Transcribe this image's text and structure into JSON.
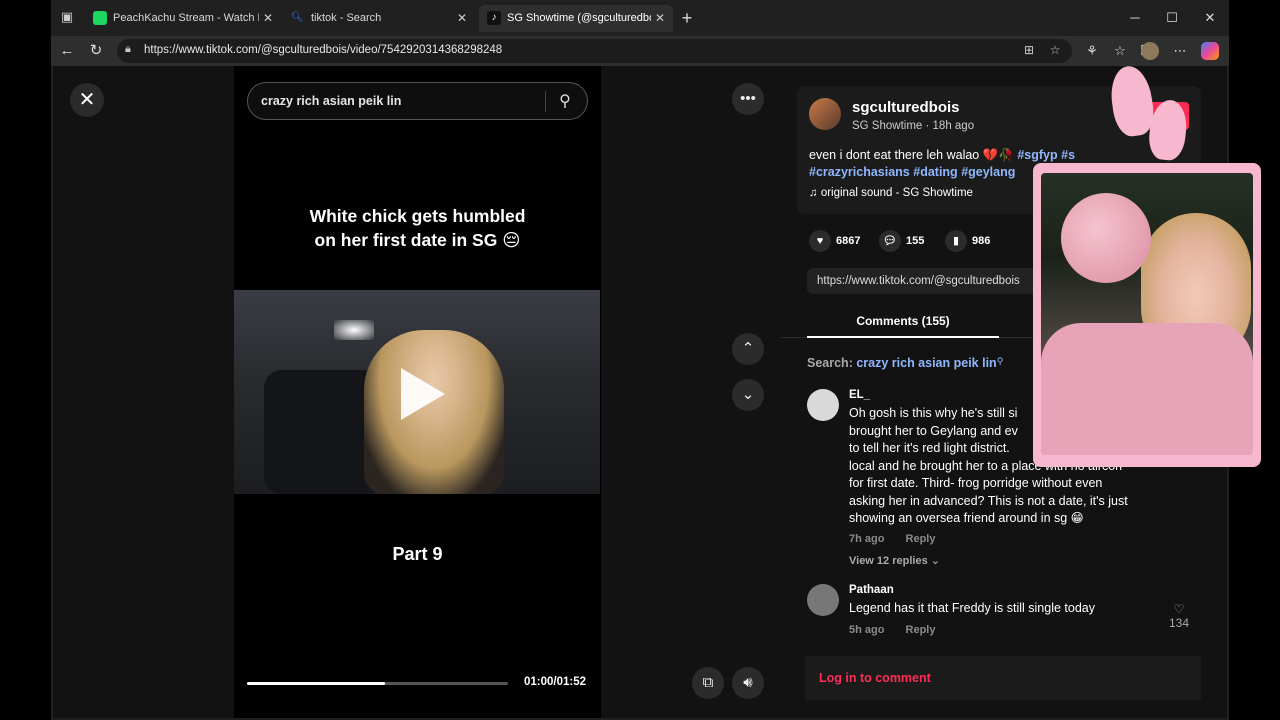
{
  "browser": {
    "tabs": [
      {
        "title": "PeachKachu Stream - Watch Live",
        "favicon_color": "#1ed760"
      },
      {
        "title": "tiktok - Search",
        "favicon_color": "#3b82f6"
      },
      {
        "title": "SG Showtime (@sgculturedbois)",
        "favicon_color": "#111111"
      }
    ],
    "url": "https://www.tiktok.com/@sgculturedbois/video/7542920314368298248"
  },
  "video": {
    "search_query": "crazy rich asian peik lin",
    "caption_line1": "White chick gets humbled",
    "caption_line2": "on her first date in SG 😔",
    "part_label": "Part 9",
    "time": "01:00/01:52",
    "progress": 0.53
  },
  "post": {
    "username": "sgculturedbois",
    "subline": "SG Showtime · 18h ago",
    "desc_text": "even i dont eat there leh walao 💔🥀 ",
    "desc_tags": [
      "#sgfyp",
      "#s",
      "#crazyrichasians",
      "#dating",
      "#geylang"
    ],
    "sound": "original sound - SG Showtime",
    "likes": "6867",
    "comments": "155",
    "saves": "986",
    "share_link": "https://www.tiktok.com/@sgculturedbois",
    "comments_tab": "Comments (155)",
    "search_label": "Search:",
    "search_term": "crazy rich asian peik lin"
  },
  "comments": [
    {
      "name": "EL_",
      "text": "Oh gosh is this why he's still si... brought her to Geylang and ev... to tell her it's red light district. ... local and he brought her to a place with no aircon for first date. Third- frog porridge without even asking her in advanced? This is not a date, it's just showing an oversea friend around in sg 😁",
      "lines": [
        "Oh gosh is this why he's still si",
        "brought her to Geylang and ev",
        "to tell her it's red light district.",
        "local and he brought her to a place with no aircon",
        "for first date. Third- frog porridge without even",
        "asking her in advanced? This is not a date, it's just",
        "showing an oversea friend around in sg 😁"
      ],
      "time": "7h ago",
      "reply": "Reply",
      "view_replies": "View 12 replies ⌄"
    },
    {
      "name": "Pathaan",
      "text": "Legend has it that Freddy is still single today",
      "time": "5h ago",
      "reply": "Reply",
      "likes": "134"
    }
  ],
  "login_text": "Log in to comment"
}
